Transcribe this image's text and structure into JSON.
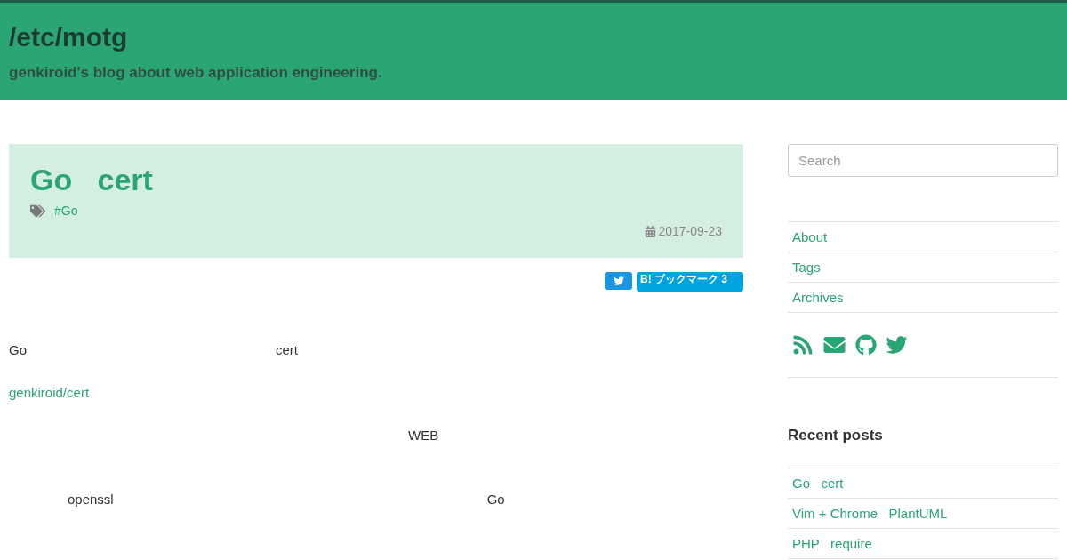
{
  "header": {
    "title": "/etc/motg",
    "tagline": "genkiroid's blog about web application engineering."
  },
  "post": {
    "title": "Go   cert",
    "tags": [
      "#Go"
    ],
    "date": "2017-09-23",
    "share": {
      "hatena_label": "B! ブックマーク",
      "hatena_count": "3"
    },
    "paragraphs": [
      {
        "kind": "text",
        "segments": [
          "Go",
          "cert"
        ]
      },
      {
        "kind": "link",
        "segments": [
          "genkiroid/cert"
        ]
      },
      {
        "kind": "text",
        "segments": [
          "WEB"
        ]
      },
      {
        "kind": "text",
        "segments": [
          "openssl",
          "Go"
        ]
      }
    ]
  },
  "sidebar": {
    "search": {
      "placeholder": "Search"
    },
    "nav": [
      "About",
      "Tags",
      "Archives"
    ],
    "recent_title": "Recent posts",
    "recent": [
      "Go   cert",
      "Vim + Chrome   PlantUML",
      "PHP   require"
    ]
  }
}
